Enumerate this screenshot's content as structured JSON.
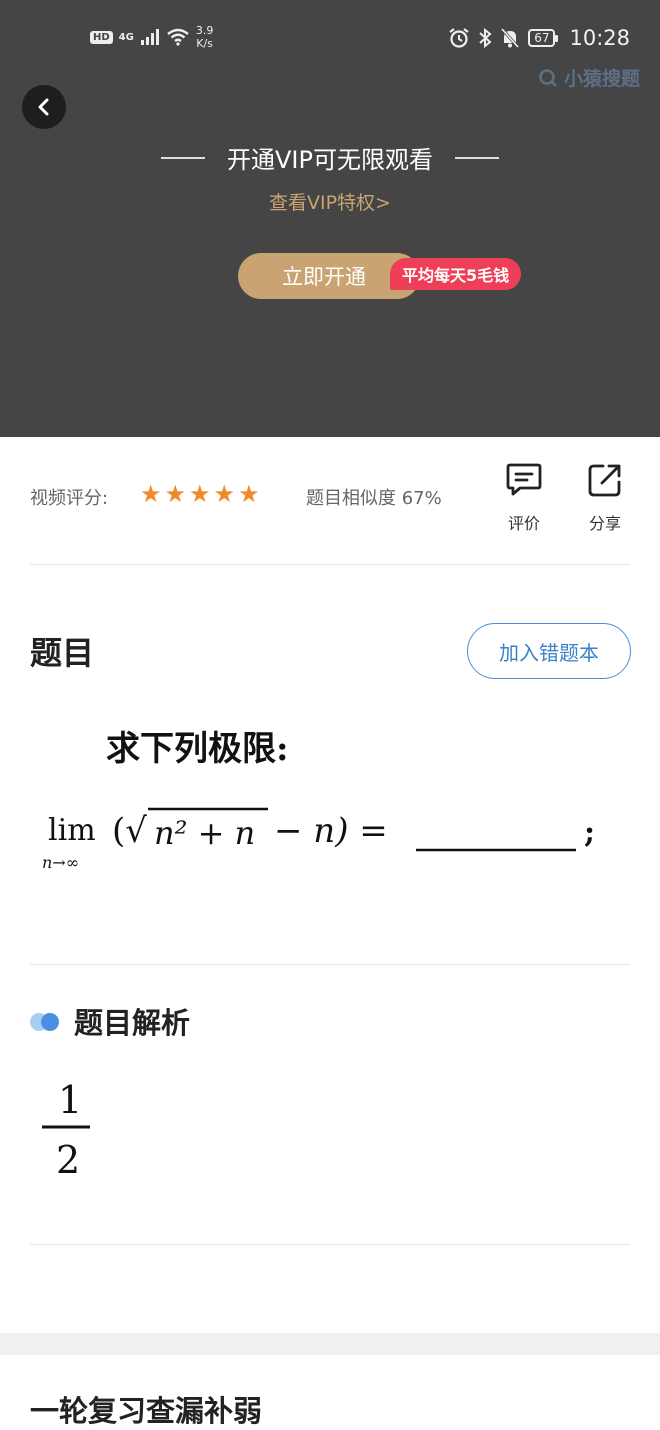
{
  "status_bar": {
    "hd": "HD",
    "network": "4G",
    "speed_value": "3.9",
    "speed_unit": "K/s",
    "battery": "67",
    "time": "10:28"
  },
  "watermark": {
    "text": "小猿搜题"
  },
  "video": {
    "vip_title": "开通VIP可无限观看",
    "vip_link": "查看VIP特权>",
    "open_button": "立即开通",
    "promo_tag": "平均每天5毛钱"
  },
  "rating": {
    "label": "视频评分:",
    "stars": 5,
    "similarity": "题目相似度 67%",
    "comment_label": "评价",
    "share_label": "分享"
  },
  "question": {
    "section_title": "题目",
    "add_button": "加入错题本",
    "prompt": "求下列极限:",
    "lim": "lim",
    "lim_sub": "n→∞",
    "expr_left": "(√",
    "expr_radicand": "n² + n",
    "expr_right": "− n) =",
    "expr_end": ";"
  },
  "analysis": {
    "title": "题目解析",
    "numerator": "1",
    "denominator": "2"
  },
  "bottom": {
    "title": "一轮复习查漏补弱"
  },
  "colors": {
    "video_bg": "#454545",
    "gold": "#c9a472",
    "promo_red": "#ef3e58",
    "star": "#f08a28",
    "blue": "#3b82c8"
  }
}
